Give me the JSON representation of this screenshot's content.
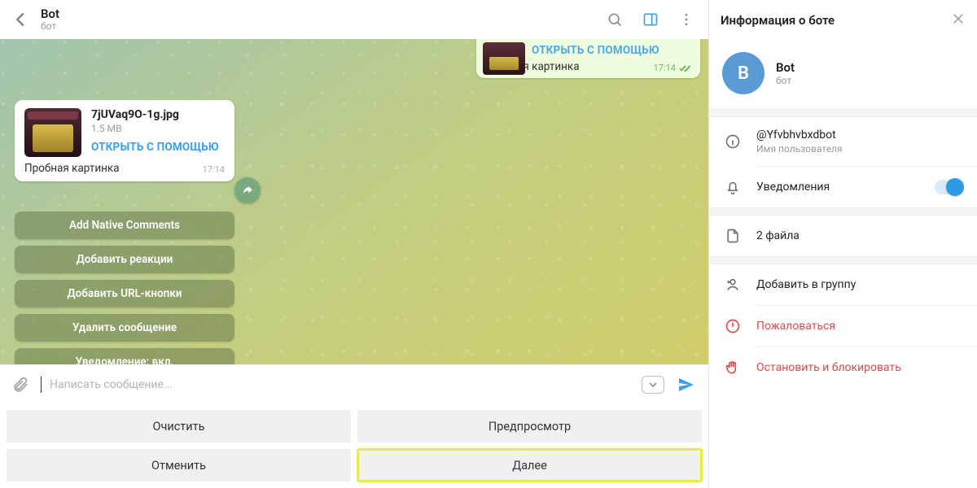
{
  "header": {
    "title": "Bot",
    "subtitle": "бот"
  },
  "out_msg": {
    "open_label": "ОТКРЫТЬ С ПОМОЩЬЮ",
    "caption": "Пробная картинка",
    "time": "17:14"
  },
  "in_msg": {
    "file_name": "7jUVaq9O-1g.jpg",
    "file_size": "1.5 MB",
    "open_label": "ОТКРЫТЬ С ПОМОЩЬЮ",
    "caption": "Пробная картинка",
    "time": "17:14"
  },
  "actions": {
    "items": [
      "Add Native Comments",
      "Добавить реакции",
      "Добавить URL-кнопки",
      "Удалить сообщение",
      "Уведомление: вкл."
    ]
  },
  "composer": {
    "placeholder": "Написать сообщение..."
  },
  "bottom": {
    "clear": "Очистить",
    "preview": "Предпросмотр",
    "cancel": "Отменить",
    "next": "Далее"
  },
  "info": {
    "panel_title": "Информация о боте",
    "avatar_letter": "B",
    "name": "Bot",
    "sub": "бот",
    "username": "@Yfvbhvbxdbot",
    "username_caption": "Имя пользователя",
    "notifications_label": "Уведомления",
    "files_label": "2 файла",
    "add_group": "Добавить в группу",
    "report": "Пожаловаться",
    "stop_block": "Остановить и блокировать"
  }
}
